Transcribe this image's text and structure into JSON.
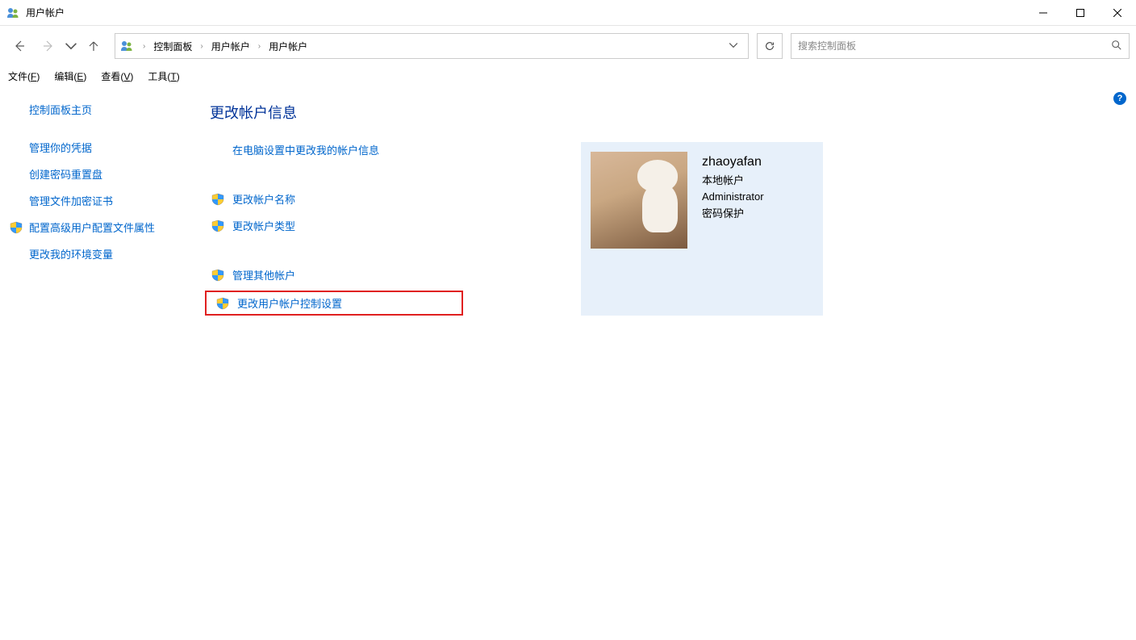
{
  "window": {
    "title": "用户帐户"
  },
  "breadcrumb": {
    "items": [
      "控制面板",
      "用户帐户",
      "用户帐户"
    ]
  },
  "search": {
    "placeholder": "搜索控制面板"
  },
  "menubar": {
    "file": "文件(",
    "file_u": "F",
    "file_end": ")",
    "edit": "编辑(",
    "edit_u": "E",
    "edit_end": ")",
    "view": "查看(",
    "view_u": "V",
    "view_end": ")",
    "tools": "工具(",
    "tools_u": "T",
    "tools_end": ")"
  },
  "sidebar": {
    "home": "控制面板主页",
    "items": [
      {
        "label": "管理你的凭据",
        "shield": false
      },
      {
        "label": "创建密码重置盘",
        "shield": false
      },
      {
        "label": "管理文件加密证书",
        "shield": false
      },
      {
        "label": "配置高级用户配置文件属性",
        "shield": true
      },
      {
        "label": "更改我的环境变量",
        "shield": false
      }
    ]
  },
  "main": {
    "heading": "更改帐户信息",
    "actions_group1": [
      {
        "label": "在电脑设置中更改我的帐户信息",
        "shield": false
      }
    ],
    "actions_group2": [
      {
        "label": "更改帐户名称",
        "shield": true
      },
      {
        "label": "更改帐户类型",
        "shield": true
      }
    ],
    "actions_group3": [
      {
        "label": "管理其他帐户",
        "shield": true
      },
      {
        "label": "更改用户帐户控制设置",
        "shield": true,
        "highlight": true
      }
    ]
  },
  "user": {
    "name": "zhaoyafan",
    "account_type": "本地帐户",
    "role": "Administrator",
    "pw_status": "密码保护"
  },
  "help": "?"
}
